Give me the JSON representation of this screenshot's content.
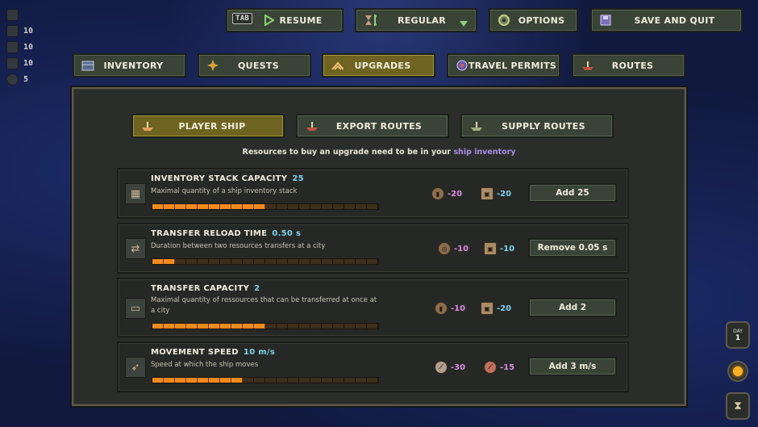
{
  "resources": [
    {
      "icon": "pickaxe-icon",
      "value": ""
    },
    {
      "icon": "crate-icon",
      "value": "10"
    },
    {
      "icon": "log-icon",
      "value": "10"
    },
    {
      "icon": "barrel-icon",
      "value": "10"
    },
    {
      "icon": "coin-icon",
      "value": "5"
    }
  ],
  "top_menu": {
    "tab_key": "TAB",
    "resume": "RESUME",
    "speed": "REGULAR",
    "options": "OPTIONS",
    "save_quit": "SAVE AND QUIT"
  },
  "main_tabs": [
    {
      "label": "INVENTORY",
      "icon": "chest-icon",
      "active": false
    },
    {
      "label": "QUESTS",
      "icon": "quest-icon",
      "active": false
    },
    {
      "label": "UPGRADES",
      "icon": "upgrade-icon",
      "active": true
    },
    {
      "label": "TRAVEL PERMITS",
      "icon": "permit-icon",
      "active": false
    },
    {
      "label": "ROUTES",
      "icon": "route-icon",
      "active": false
    }
  ],
  "sub_tabs": [
    {
      "label": "PLAYER SHIP",
      "icon": "ship-icon",
      "active": true
    },
    {
      "label": "EXPORT ROUTES",
      "icon": "export-ship-icon",
      "active": false
    },
    {
      "label": "SUPPLY ROUTES",
      "icon": "supply-ship-icon",
      "active": false
    }
  ],
  "notice": {
    "prefix": "Resources to buy an upgrade need to be in your ",
    "highlight": "ship inventory"
  },
  "upgrades": [
    {
      "title": "INVENTORY STACK CAPACITY",
      "value": "25",
      "desc": "Maximal quantity of a ship inventory stack",
      "progress": 0.5,
      "cost1": {
        "icon": "barrel-icon",
        "amount": "-20"
      },
      "cost2": {
        "icon": "crate-icon",
        "amount": "-20"
      },
      "button": "Add 25",
      "icon": "stack-icon"
    },
    {
      "title": "TRANSFER RELOAD TIME",
      "value": "0.50 s",
      "desc": "Duration between two resources transfers at a city",
      "progress": 0.1,
      "cost1": {
        "icon": "magnifier-icon",
        "amount": "-10"
      },
      "cost2": {
        "icon": "crate-icon",
        "amount": "-10"
      },
      "button": "Remove 0.05 s",
      "icon": "transfer-icon"
    },
    {
      "title": "TRANSFER CAPACITY",
      "value": "2",
      "desc": "Maximal quantity of ressources that can be transferred at once at a city",
      "progress": 0.5,
      "cost1": {
        "icon": "barrel-icon",
        "amount": "-10"
      },
      "cost2": {
        "icon": "crate-icon",
        "amount": "-20"
      },
      "button": "Add 2",
      "icon": "capacity-icon"
    },
    {
      "title": "MOVEMENT SPEED",
      "value": "10 m/s",
      "desc": "Speed at which the ship moves",
      "progress": 0.4,
      "cost1": {
        "icon": "plank-icon",
        "amount": "-30"
      },
      "cost2": {
        "icon": "rope-icon",
        "amount": "-15"
      },
      "button": "Add 3 m/s",
      "icon": "speed-icon"
    }
  ],
  "day": {
    "label": "DAY",
    "value": "1"
  }
}
